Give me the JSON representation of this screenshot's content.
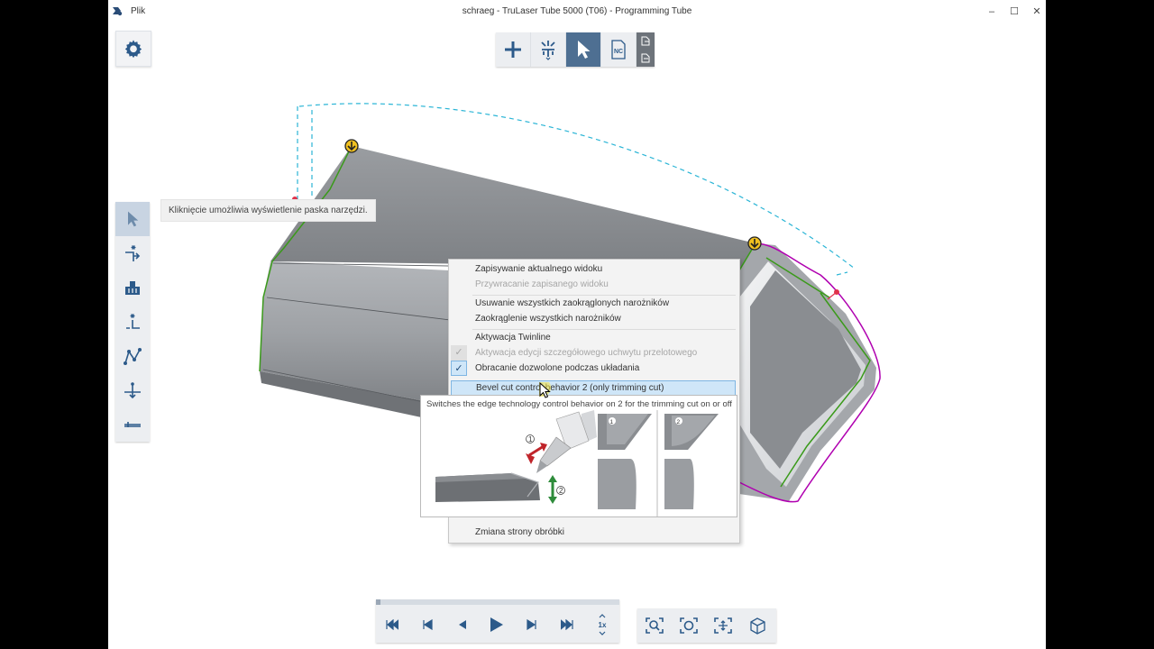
{
  "window": {
    "title": "schraeg - TruLaser Tube 5000 (T06) - Programming Tube",
    "menu": "Plik",
    "controls": [
      "minimize",
      "maximize",
      "close"
    ],
    "minimize_glyph": "–",
    "maximize_glyph": "☐",
    "close_glyph": "✕"
  },
  "top_toolbar": {
    "items": [
      {
        "icon": "plus-icon",
        "active": false
      },
      {
        "icon": "part-settings-icon",
        "active": false
      },
      {
        "icon": "select-pointer-icon",
        "active": true
      },
      {
        "icon": "nc-icon",
        "label": "NC",
        "active": false
      }
    ],
    "export_icons": [
      "export-icon",
      "import-icon"
    ]
  },
  "left_toolbar": {
    "items": [
      {
        "icon": "select-pointer-icon",
        "active": true
      },
      {
        "icon": "lead-in-icon",
        "active": false
      },
      {
        "icon": "parts-group-icon",
        "active": false
      },
      {
        "icon": "start-point-icon",
        "active": false
      },
      {
        "icon": "contour-path-icon",
        "active": false
      },
      {
        "icon": "micro-joint-icon",
        "active": false
      },
      {
        "icon": "separation-cut-icon",
        "active": false
      }
    ]
  },
  "toolbar_tooltip": "Kliknięcie umożliwia wyświetlenie paska narzędzi.",
  "context_menu": {
    "items": [
      {
        "label": "Zapisywanie aktualnego widoku",
        "enabled": true
      },
      {
        "label": "Przywracanie zapisanego widoku",
        "enabled": false
      },
      {
        "label": "Usuwanie wszystkich zaokrąglonych narożników",
        "enabled": true
      },
      {
        "label": "Zaokrąglenie wszystkich narożników",
        "enabled": true
      },
      {
        "label": "Aktywacja Twinline",
        "enabled": true
      },
      {
        "label": "Aktywacja edycji szczegółowego uchwytu przelotowego",
        "enabled": false,
        "checked": true
      },
      {
        "label": "Obracanie dozwolone podczas układania",
        "enabled": true,
        "checked": true
      },
      {
        "label": "Bevel cut control behavior 2 (only trimming cut)",
        "enabled": true,
        "highlighted": true
      },
      {
        "label": "Zmiana strony obróbki",
        "enabled": true
      }
    ],
    "check_glyph": "✓"
  },
  "bevel_tooltip": {
    "text": "Switches the edge technology control behavior on 2 for the trimming cut on or off",
    "markers": [
      "1",
      "2"
    ]
  },
  "playback": {
    "progress": 0.02,
    "speed": "1x",
    "buttons": [
      "skip-to-start-icon",
      "step-back-icon",
      "reverse-icon",
      "play-icon",
      "step-forward-icon",
      "skip-to-end-icon",
      "speed-icon"
    ]
  },
  "view_controls": {
    "buttons": [
      "zoom-window-icon",
      "zoom-fit-icon",
      "zoom-extents-icon",
      "3d-view-icon"
    ]
  },
  "colors": {
    "toolbar_active": "#4e6f92",
    "toolbar_bg": "#eceef1",
    "menu_highlight": "#cfe6f8",
    "contour_green": "#3a9a1a",
    "contour_magenta": "#b000b0",
    "path_dashed": "#2bb5d6",
    "tube_gray": "#8c8f93"
  }
}
